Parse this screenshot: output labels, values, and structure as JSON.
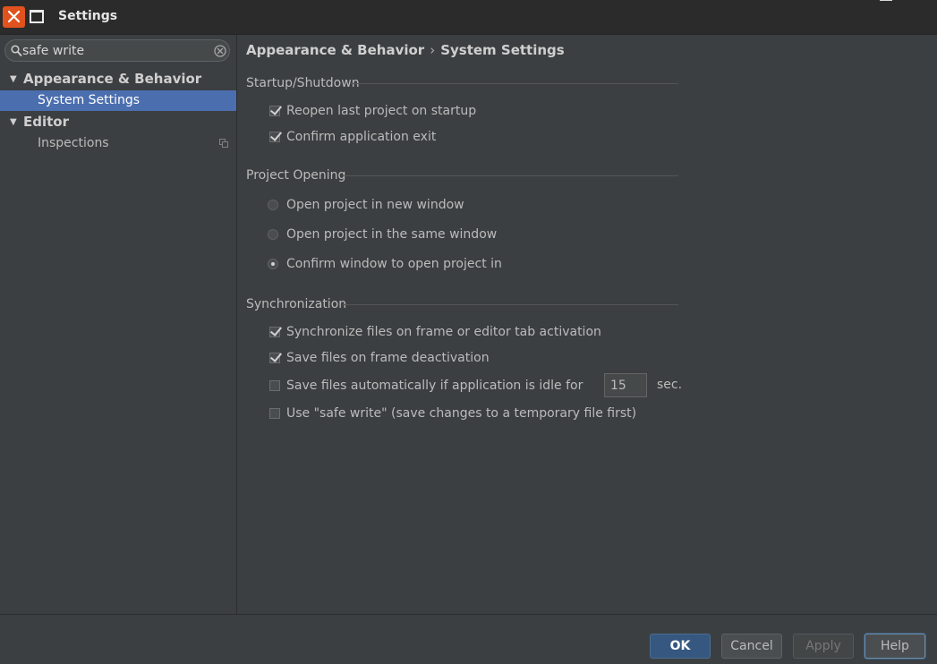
{
  "window": {
    "title": "Settings",
    "close_icon": "close-icon",
    "maximize_icon": "maximize-icon"
  },
  "search": {
    "value": "safe write",
    "search_icon": "search-icon",
    "clear_icon": "clear-icon"
  },
  "tree": {
    "groups": [
      {
        "label": "Appearance & Behavior",
        "expanded": true,
        "children": [
          {
            "label": "System Settings",
            "selected": true
          }
        ]
      },
      {
        "label": "Editor",
        "expanded": true,
        "children": [
          {
            "label": "Inspections",
            "selected": false,
            "icon": "copy-icon"
          }
        ]
      }
    ]
  },
  "breadcrumb": {
    "parent": "Appearance & Behavior",
    "separator": "›",
    "current": "System Settings"
  },
  "startup": {
    "title": "Startup/Shutdown",
    "reopen_label": "Reopen last project on startup",
    "reopen_checked": true,
    "confirm_exit_label": "Confirm application exit",
    "confirm_exit_checked": true
  },
  "project_opening": {
    "title": "Project Opening",
    "options": [
      {
        "label": "Open project in new window",
        "selected": false
      },
      {
        "label": "Open project in the same window",
        "selected": false
      },
      {
        "label": "Confirm window to open project in",
        "selected": true
      }
    ]
  },
  "sync": {
    "title": "Synchronization",
    "sync_files_label": "Synchronize files on frame or editor tab activation",
    "sync_files_checked": true,
    "save_deactivation_label": "Save files on frame deactivation",
    "save_deactivation_checked": true,
    "save_idle_label": "Save files automatically if application is idle for",
    "save_idle_checked": false,
    "idle_seconds": "15",
    "seconds_unit": "sec.",
    "safe_write_label": "Use \"safe write\" (save changes to a temporary file first)",
    "safe_write_checked": false
  },
  "buttons": {
    "ok": "OK",
    "cancel": "Cancel",
    "apply": "Apply",
    "help": "Help"
  },
  "colors": {
    "accent_selection": "#4b6eaf",
    "close_button": "#e0531e",
    "ok_button": "#365880"
  }
}
